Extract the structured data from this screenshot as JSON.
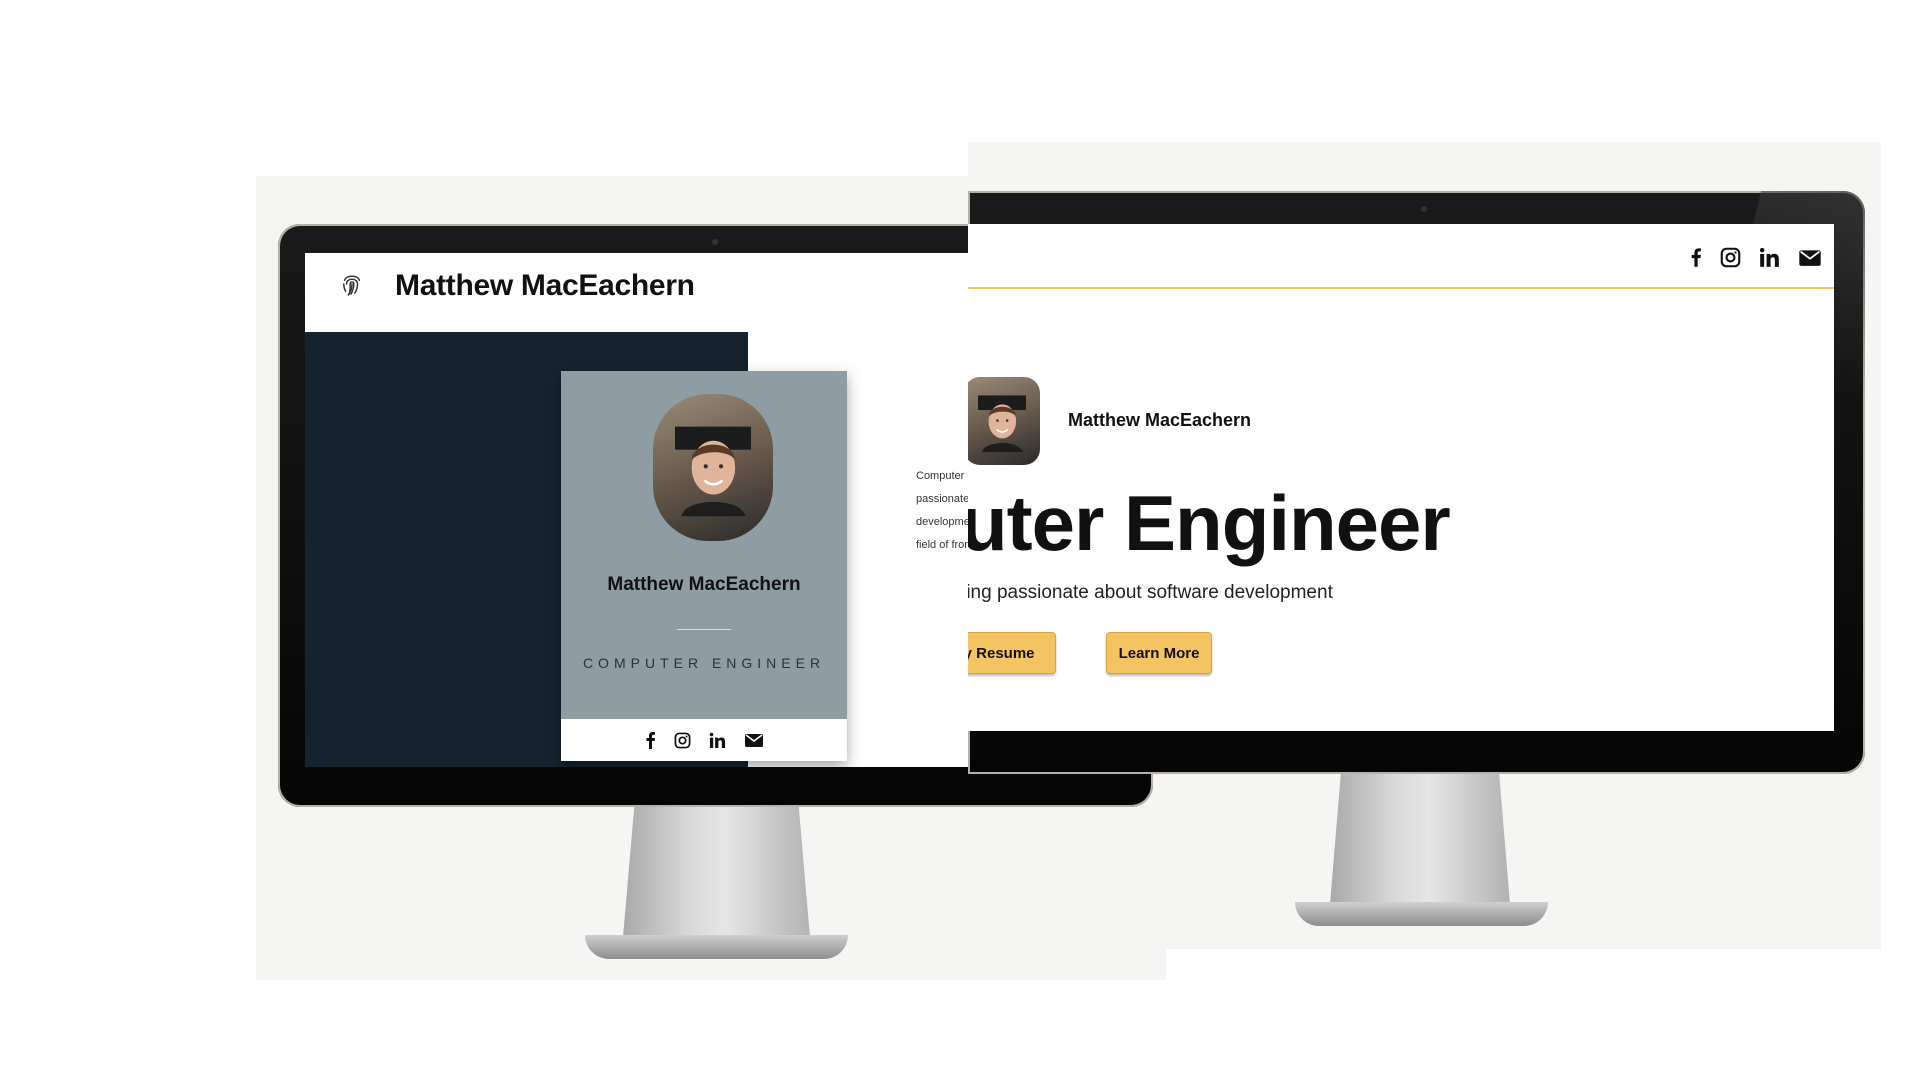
{
  "left_site": {
    "brand": "Matthew MacEachern",
    "card": {
      "name": "Matthew MacEachern",
      "role": "COMPUTER ENGINEER",
      "social_icons": [
        "facebook-icon",
        "instagram-icon",
        "linkedin-icon",
        "email-icon"
      ]
    },
    "about_lines": [
      "Computer  engineer  from  Ontario  Ca",
      "passionate  about  software  innovation",
      "development,  with  a  wide  range  of",
      "field  of  front  end  development."
    ]
  },
  "right_site": {
    "social_icons": [
      "facebook-icon",
      "instagram-icon",
      "linkedin-icon",
      "email-icon"
    ],
    "name": "Matthew MacEachern",
    "title": "uter Engineer",
    "subtitle": "ring passionate about software development",
    "buttons": {
      "resume": "ly Resume",
      "learn_more": "Learn More"
    }
  },
  "colors": {
    "dark_panel": "#14232d",
    "card_gray": "#8e9da3",
    "accent_yellow": "#f4c463",
    "bezel": "#0a0a0a"
  }
}
